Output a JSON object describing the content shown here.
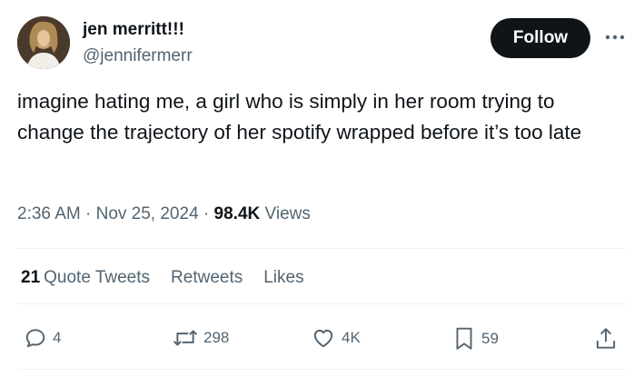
{
  "author": {
    "name": "jen merritt!!!",
    "handle": "@jennifermerr"
  },
  "follow_label": "Follow",
  "tweet_text": "imagine hating me, a girl who is simply in her room trying to change the trajectory of her spotify wrapped before it’s too late",
  "meta": {
    "time": "2:36 AM",
    "separator": " · ",
    "date": "Nov 25, 2024",
    "views_count": "98.4K",
    "views_label": "Views"
  },
  "stats": {
    "quote_count": "21",
    "quote_label": "Quote Tweets",
    "retweets_label": "Retweets",
    "likes_label": "Likes"
  },
  "actions": {
    "replies": "4",
    "retweets": "298",
    "likes": "4K",
    "bookmarks": "59"
  },
  "icons": [
    "reply-icon",
    "retweet-icon",
    "like-icon",
    "bookmark-icon",
    "share-icon",
    "more-icon"
  ],
  "colors": {
    "text": "#0f1419",
    "secondary": "#536471",
    "button": "#0f1419",
    "divider": "#eff3f4"
  }
}
